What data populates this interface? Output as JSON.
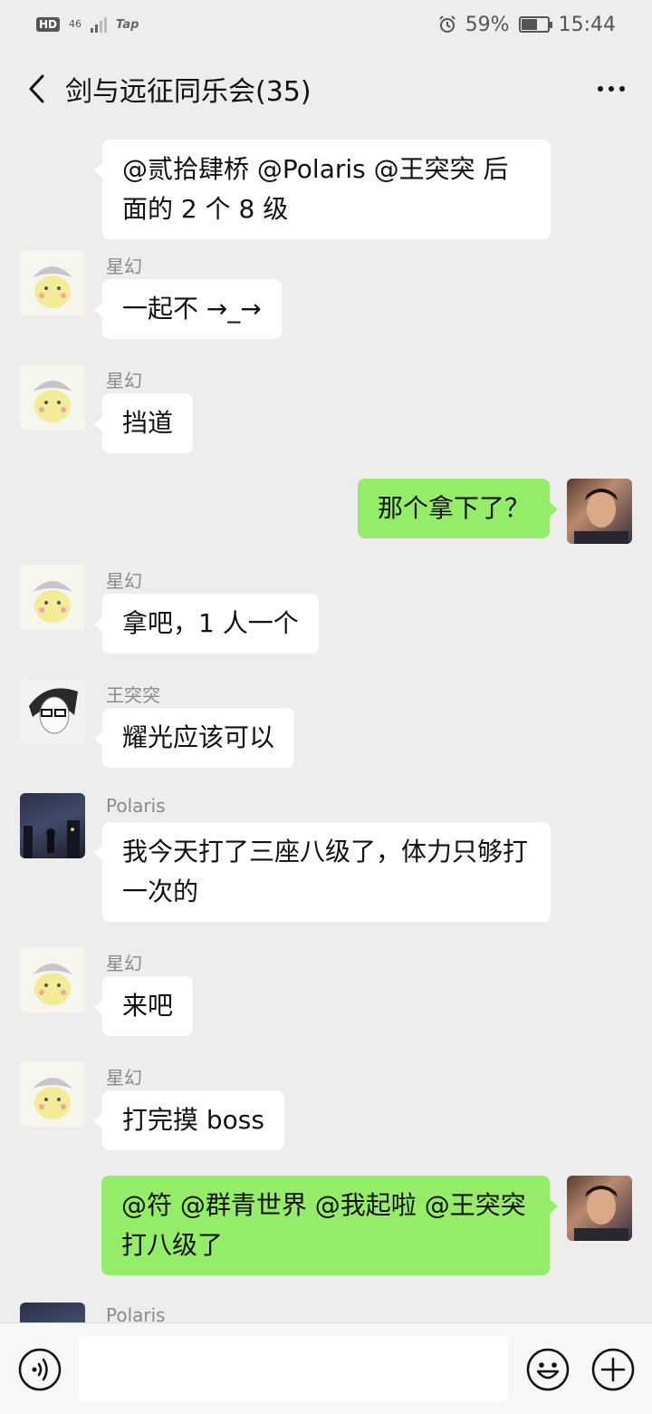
{
  "status_bar": {
    "hd": "HD",
    "network": "46",
    "tap": "Tap",
    "battery_percent": "59%",
    "battery_level": 0.59,
    "time": "15:44"
  },
  "header": {
    "title": "剑与远征同乐会(35)",
    "back_icon": "chevron-left-icon",
    "more_icon": "more-dots-icon"
  },
  "messages": [
    {
      "side": "left",
      "avatar": "pikachu",
      "sender": "",
      "text": "@贰拾肆桥 @Polaris @王突突  后面的 2 个 8 级"
    },
    {
      "side": "left",
      "avatar": "pikachu",
      "sender": "星幻",
      "text": "一起不 →_→"
    },
    {
      "side": "left",
      "avatar": "pikachu",
      "sender": "星幻",
      "text": "挡道"
    },
    {
      "side": "right",
      "avatar": "self",
      "sender": "",
      "text": "那个拿下了？"
    },
    {
      "side": "left",
      "avatar": "pikachu",
      "sender": "星幻",
      "text": "拿吧，1 人一个"
    },
    {
      "side": "left",
      "avatar": "glasses",
      "sender": "王突突",
      "text": "耀光应该可以"
    },
    {
      "side": "left",
      "avatar": "city",
      "sender": "Polaris",
      "text": "我今天打了三座八级了，体力只够打一次的"
    },
    {
      "side": "left",
      "avatar": "pikachu",
      "sender": "星幻",
      "text": "来吧"
    },
    {
      "side": "left",
      "avatar": "pikachu",
      "sender": "星幻",
      "text": "打完摸 boss"
    },
    {
      "side": "right",
      "avatar": "self",
      "sender": "",
      "text": "@符  @群青世界  @我起啦  @王突突  打八级了"
    },
    {
      "side": "left",
      "avatar": "city",
      "sender": "Polaris",
      "text": ""
    }
  ],
  "input_bar": {
    "placeholder": "",
    "voice_icon": "voice-icon",
    "emoji_icon": "emoji-icon",
    "plus_icon": "plus-icon"
  },
  "colors": {
    "background": "#ededed",
    "bubble_self": "#95ec69",
    "bubble_other": "#ffffff",
    "sender_name": "#8a8a8a"
  }
}
